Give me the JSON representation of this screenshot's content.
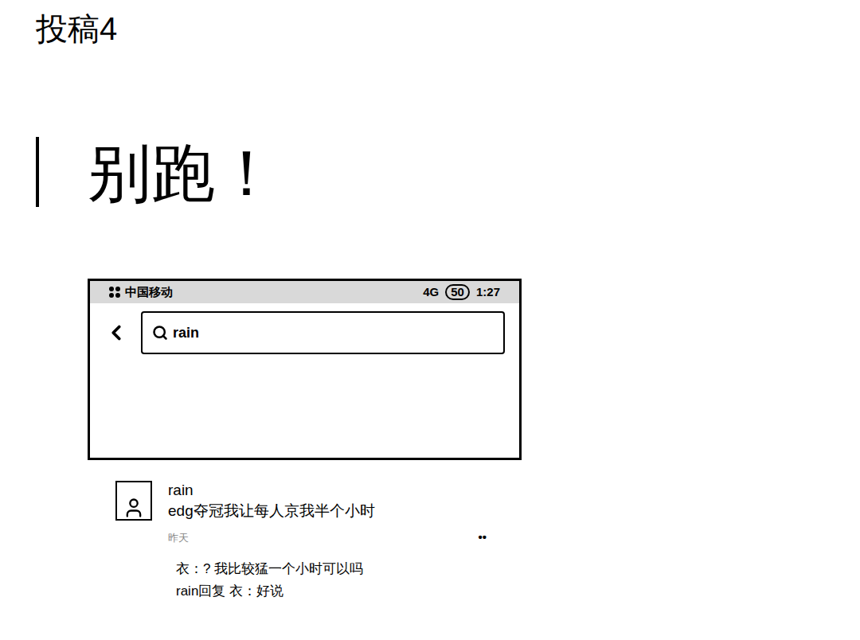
{
  "page": {
    "title": "投稿4",
    "heading": "别跑！"
  },
  "screenshot": {
    "status_bar": {
      "carrier": "中国移动",
      "signal": "4G",
      "battery": "50",
      "time": "1:27"
    },
    "search": {
      "value": "rain"
    }
  },
  "comment": {
    "author": "rain",
    "text": "edg夺冠我让每人京我半个小时",
    "meta": "昨天",
    "more": "••",
    "replies": [
      {
        "text": "衣：? 我比较猛一个小时可以吗"
      },
      {
        "text": "rain回复 衣：好说"
      }
    ]
  }
}
